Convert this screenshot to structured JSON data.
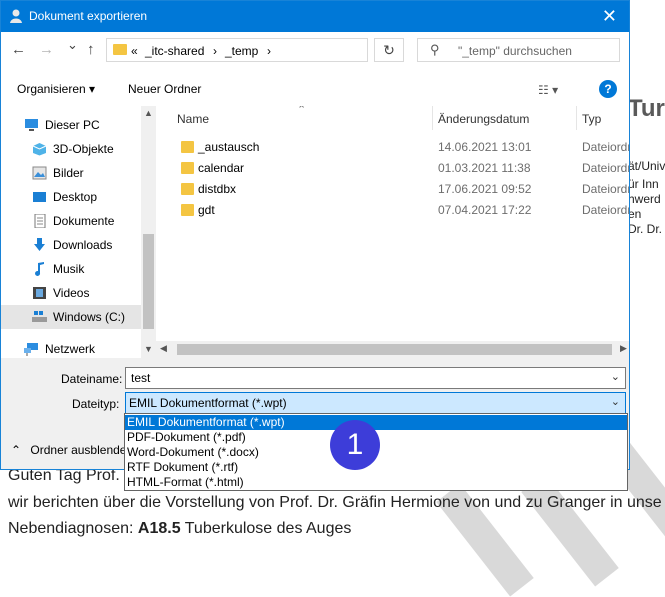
{
  "dialog": {
    "title": "Dokument exportieren",
    "close_glyph": "✕"
  },
  "nav": {
    "back_glyph": "←",
    "forward_glyph": "→",
    "recent_glyph": "⌄",
    "up_glyph": "↑",
    "address_prefix": "«",
    "address_seg1": "_itc-shared",
    "address_seg2": "_temp",
    "address_sep": "›",
    "refresh_glyph": "↻",
    "search_placeholder": "\"_temp\" durchsuchen",
    "search_glyph": "⚲"
  },
  "toolbar": {
    "organize_label": "Organisieren ▾",
    "new_folder_label": "Neuer Ordner",
    "view_glyph": "☷ ▾",
    "help_glyph": "?"
  },
  "navpane": {
    "items": [
      {
        "label": "Dieser PC",
        "icon": "computer-icon"
      },
      {
        "label": "3D-Objekte",
        "icon": "cube-icon"
      },
      {
        "label": "Bilder",
        "icon": "pictures-icon"
      },
      {
        "label": "Desktop",
        "icon": "desktop-icon"
      },
      {
        "label": "Dokumente",
        "icon": "documents-icon"
      },
      {
        "label": "Downloads",
        "icon": "download-icon"
      },
      {
        "label": "Musik",
        "icon": "music-icon"
      },
      {
        "label": "Videos",
        "icon": "videos-icon"
      },
      {
        "label": "Windows (C:)",
        "icon": "drive-icon"
      },
      {
        "label": "Netzwerk",
        "icon": "network-icon"
      }
    ]
  },
  "files": {
    "columns": [
      "Name",
      "Änderungsdatum",
      "Typ"
    ],
    "rows": [
      {
        "name": "_austausch",
        "date": "14.06.2021 13:01",
        "type": "Dateiordner"
      },
      {
        "name": "calendar",
        "date": "01.03.2021 11:38",
        "type": "Dateiordner"
      },
      {
        "name": "distdbx",
        "date": "17.06.2021 09:52",
        "type": "Dateiordner"
      },
      {
        "name": "gdt",
        "date": "07.04.2021 17:22",
        "type": "Dateiordner"
      }
    ]
  },
  "form": {
    "filename_label": "Dateiname:",
    "filename_value": "test",
    "filetype_label": "Dateityp:",
    "filetype_value": "EMIL Dokumentformat (*.wpt)",
    "hide_folders_label": "Ordner ausblende",
    "filetype_options": [
      "EMIL Dokumentformat (*.wpt)",
      "PDF-Dokument (*.pdf)",
      "Word-Dokument (*.docx)",
      "RTF Dokument (*.rtf)",
      "HTML-Format (*.html)"
    ]
  },
  "badge": {
    "number": "1",
    "color": "#3d3dd9"
  },
  "background_doc": {
    "heading": "Tur",
    "side_lines": [
      "ät/Unive",
      "ür Inn",
      "hwerd",
      "en",
      "Dr. Dr."
    ],
    "line1": "Guten Tag Prof.",
    "line2": "wir berichten über die Vorstellung von Prof. Dr. Gräfin Hermione von und zu Granger in unse",
    "line3_prefix": "Nebendiagnosen: ",
    "line3_code": "A18.5",
    "line3_rest": " Tuberkulose des Auges"
  },
  "colors": {
    "accent": "#0078d7",
    "folder": "#f4c542",
    "selection": "#cce8ff"
  }
}
